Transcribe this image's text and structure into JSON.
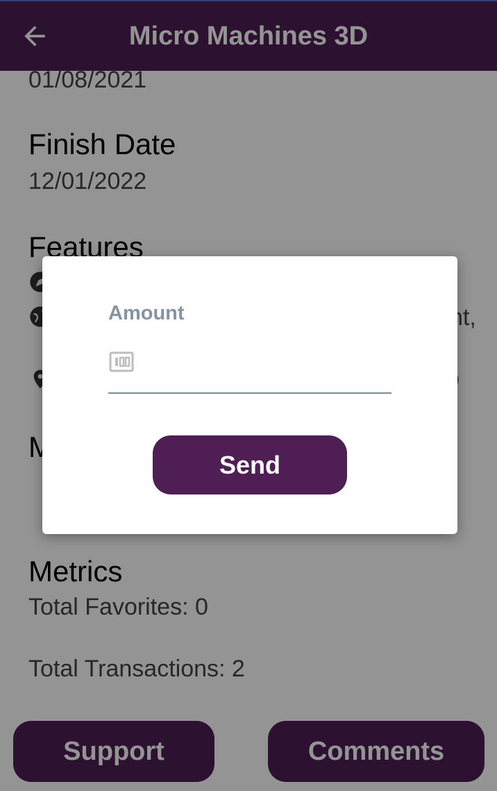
{
  "appbar": {
    "title": "Micro Machines 3D",
    "back_icon": "arrow-left-icon"
  },
  "details": {
    "start_date_value": "01/08/2021",
    "finish_date_label": "Finish Date",
    "finish_date_value": "12/01/2022",
    "features_label": "Features",
    "feature_partial_text_1": "nt,",
    "feature_partial_text_2": "o",
    "feature_icons": [
      "compass-icon",
      "globe-icon",
      "location-pin-icon"
    ],
    "partial_heading": "M",
    "metrics_label": "Metrics",
    "total_favorites": "Total Favorites: 0",
    "total_transactions": "Total Transactions: 2"
  },
  "bottom_bar": {
    "support_label": "Support",
    "comments_label": "Comments"
  },
  "dialog": {
    "amount_label": "Amount",
    "amount_value": "",
    "amount_icon": "money-icon",
    "send_label": "Send"
  },
  "colors": {
    "primary": "#4e1e55",
    "label_gray": "#8593a3",
    "scrim": "rgba(0,0,0,0.42)"
  }
}
